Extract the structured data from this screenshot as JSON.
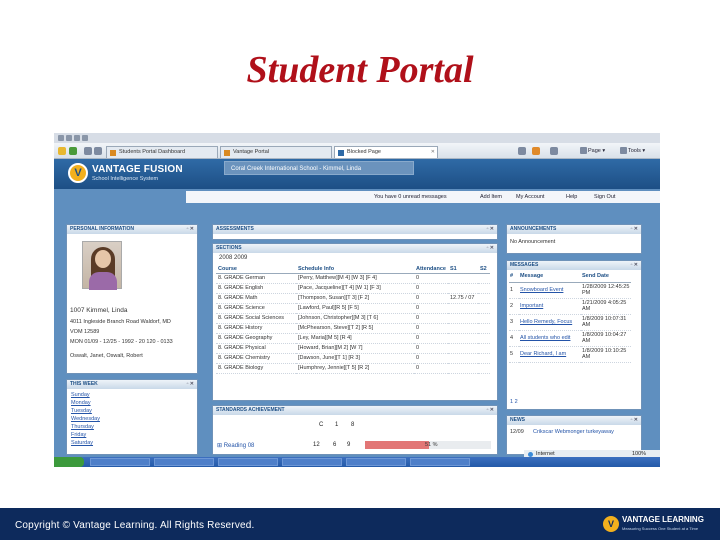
{
  "slide": {
    "title": "Student Portal",
    "footer_text": "Copyright © Vantage Learning. All Rights Reserved.",
    "footer_logo": {
      "name": "VANTAGE LEARNING",
      "tagline": "Measuring Success One Student at a Time"
    }
  },
  "browser": {
    "tabs": [
      {
        "label": "Students Portal Dashboard",
        "active": false
      },
      {
        "label": "Vantage Portal",
        "active": false
      },
      {
        "label": "Blocked Page",
        "active": true
      }
    ],
    "commands": [
      "Page",
      "Tools"
    ]
  },
  "portal": {
    "logo_text": "VANTAGE FUSION",
    "logo_sub": "School Intelligence System",
    "school": "Coral Creek International School - Kimmel, Linda",
    "message_bar": [
      "You have 0 unread messages",
      "Add Item",
      "My Account",
      "Help",
      "Sign Out"
    ],
    "personal": {
      "title": "PERSONAL INFORMATION",
      "name": "1007 Kimmel, Linda",
      "lines": [
        "4011 Ingleside Branch Road Waldorf, MD",
        "VOM 12589",
        "MON 01/09 - 12/25 - 1992 - 20 120 - 0133",
        "Oswalt, Janet, Oswalt, Robert"
      ]
    },
    "this_week": {
      "title": "THIS WEEK",
      "days": [
        "Sunday",
        "Monday",
        "Tuesday",
        "Wednesday",
        "Thursday",
        "Friday",
        "Saturday"
      ]
    },
    "assessments_title": "ASSESSMENTS",
    "sections": {
      "title": "SECTIONS",
      "year": "2008 2009",
      "columns": [
        "Course",
        "Schedule Info",
        "Attendance",
        "S1",
        "S2"
      ],
      "rows": [
        [
          "8. GRADE German",
          "[Perry, Matthew][M 4] [W 3] [F 4]",
          "0",
          "",
          ""
        ],
        [
          "8. GRADE English",
          "[Pace, Jacqueline][T 4] [W 1] [F 3]",
          "0",
          "",
          ""
        ],
        [
          "8. GRADE Math",
          "[Thompson, Susan][T 3] [F 2]",
          "0",
          "12.75 / 07",
          ""
        ],
        [
          "8. GRADE Science",
          "[Lawford, Paul][R 5] [F 5]",
          "0",
          "",
          ""
        ],
        [
          "8. GRADE Social Sciences",
          "[Johnson, Christopher][M 3] [T 6]",
          "0",
          "",
          ""
        ],
        [
          "8. GRADE History",
          "[McPhearson, Steve][T 2] [R 5]",
          "0",
          "",
          ""
        ],
        [
          "8. GRADE Geography",
          "[Ley, Maria][M 5] [R 4]",
          "0",
          "",
          ""
        ],
        [
          "8. GRADE Physical",
          "[Howard, Brian][M 2] [W 7]",
          "0",
          "",
          ""
        ],
        [
          "8. GRADE Chemistry",
          "[Dawson, June][T 1] [R 3]",
          "0",
          "",
          ""
        ],
        [
          "8. GRADE Biology",
          "[Humphrey, Jennie][T 5] [R 2]",
          "0",
          "",
          ""
        ]
      ]
    },
    "standards": {
      "title": "STANDARDS ACHIEVEMENT",
      "headers": [
        "C",
        "1",
        "8"
      ],
      "row": {
        "label": "Reading 08",
        "c1": "12",
        "c2": "6",
        "c3": "9",
        "percent": "51 %",
        "fraction": 0.51
      }
    },
    "announcements": {
      "title": "ANNOUNCEMENTS",
      "text": "No Announcement"
    },
    "messages": {
      "title": "MESSAGES",
      "columns": [
        "#",
        "Message",
        "Send Date"
      ],
      "rows": [
        [
          "1",
          "Snowboard Event",
          "1/28/2009 12:45:25 PM"
        ],
        [
          "2",
          "Important",
          "1/21/2009 4:05:25 AM"
        ],
        [
          "3",
          "Hello Remedy, Focus",
          "1/8/2009 10:07:31 AM"
        ],
        [
          "4",
          "All students who edit",
          "1/8/2009 10:04:27 AM"
        ],
        [
          "5",
          "Dear Richard, I am",
          "1/8/2009 10:10:25 AM"
        ]
      ],
      "pager": "1 2"
    },
    "news": {
      "title": "NEWS",
      "date": "12/09",
      "text": "Crikscar Webmonger turkeyaway"
    }
  },
  "status_bar": {
    "zone": "Internet",
    "zoom": "100%"
  }
}
